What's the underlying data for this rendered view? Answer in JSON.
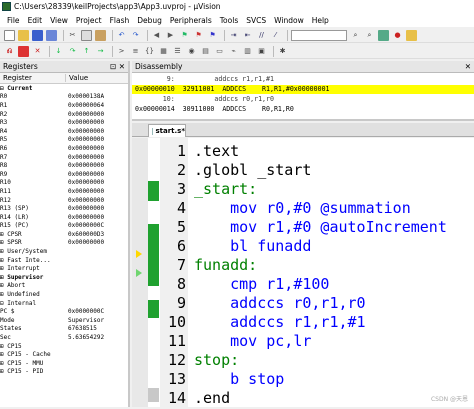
{
  "window": {
    "title": "C:\\Users\\28339\\keilProjects\\app3\\App3.uvproj - µVision"
  },
  "menu": [
    "File",
    "Edit",
    "View",
    "Project",
    "Flash",
    "Debug",
    "Peripherals",
    "Tools",
    "SVCS",
    "Window",
    "Help"
  ],
  "registers": {
    "title": "Registers",
    "col_register": "Register",
    "col_value": "Value",
    "rows": [
      {
        "n": "⊟ Current",
        "v": ""
      },
      {
        "n": "    R0",
        "v": "0x0000138A"
      },
      {
        "n": "    R1",
        "v": "0x00000064"
      },
      {
        "n": "    R2",
        "v": "0x00000000"
      },
      {
        "n": "    R3",
        "v": "0x00000000"
      },
      {
        "n": "    R4",
        "v": "0x00000000"
      },
      {
        "n": "    R5",
        "v": "0x00000000"
      },
      {
        "n": "    R6",
        "v": "0x00000000"
      },
      {
        "n": "    R7",
        "v": "0x00000000"
      },
      {
        "n": "    R8",
        "v": "0x00000000"
      },
      {
        "n": "    R9",
        "v": "0x00000000"
      },
      {
        "n": "    R10",
        "v": "0x00000000"
      },
      {
        "n": "    R11",
        "v": "0x00000000"
      },
      {
        "n": "    R12",
        "v": "0x00000000"
      },
      {
        "n": "    R13 (SP)",
        "v": "0x00000000"
      },
      {
        "n": "    R14 (LR)",
        "v": "0x00000000"
      },
      {
        "n": "    R15 (PC)",
        "v": "0x0000000C"
      },
      {
        "n": "  ⊞ CPSR",
        "v": "0x600000D3"
      },
      {
        "n": "  ⊞ SPSR",
        "v": "0x00000000"
      },
      {
        "n": "⊞ User/System",
        "v": ""
      },
      {
        "n": "⊞ Fast Inte...",
        "v": ""
      },
      {
        "n": "⊞ Interrupt",
        "v": ""
      },
      {
        "n": "⊞ Supervisor",
        "v": ""
      },
      {
        "n": "⊞ Abort",
        "v": ""
      },
      {
        "n": "⊞ Undefined",
        "v": ""
      },
      {
        "n": "⊟ Internal",
        "v": ""
      },
      {
        "n": "    PC  $",
        "v": "0x0000000C"
      },
      {
        "n": "    Mode",
        "v": "Supervisor"
      },
      {
        "n": "    States",
        "v": "67638515"
      },
      {
        "n": "    Sec",
        "v": "5.63654292"
      },
      {
        "n": "⊞ CP15",
        "v": ""
      },
      {
        "n": "⊞ CP15 - Cache",
        "v": ""
      },
      {
        "n": "⊞ CP15 - MMU",
        "v": ""
      },
      {
        "n": "⊞ CP15 - PID",
        "v": ""
      }
    ]
  },
  "disassembly": {
    "title": "Disassembly",
    "rows": [
      {
        "t": "        9:          addccs r1,r1,#1",
        "hl": false
      },
      {
        "t": "0x00000010  32911001  ADDCCS    R1,R1,#0x00000001",
        "hl": true
      },
      {
        "t": "       10:          addccs r0,r1,r0",
        "hl": false
      },
      {
        "t": "0x00000014  30911000  ADDCCS    R0,R1,R0",
        "hl": false
      }
    ]
  },
  "editor": {
    "tab": "start.s*",
    "lines": [
      {
        "num": "1",
        "code": ".text"
      },
      {
        "num": "2",
        "code": ".globl _start"
      },
      {
        "num": "3",
        "code": "_start:"
      },
      {
        "num": "4",
        "code": "    mov r0,#0 @summation"
      },
      {
        "num": "5",
        "code": "    mov r1,#0 @autoIncrement"
      },
      {
        "num": "6",
        "code": "    bl funadd"
      },
      {
        "num": "7",
        "code": "funadd:"
      },
      {
        "num": "8",
        "code": "    cmp r1,#100"
      },
      {
        "num": "9",
        "code": "    addccs r0,r1,r0"
      },
      {
        "num": "10",
        "code": "    addccs r1,r1,#1"
      },
      {
        "num": "11",
        "code": "    mov pc,lr"
      },
      {
        "num": "12",
        "code": "stop:"
      },
      {
        "num": "13",
        "code": "    b stop"
      },
      {
        "num": "14",
        "code": ".end"
      }
    ]
  },
  "watermark": "CSDN @天恩",
  "colors": {
    "coverage_green": "#1fa12f",
    "current_line": "#ffff00",
    "label": "#008000",
    "keyword": "#0000ff"
  },
  "icons": [
    "new-file-icon",
    "open-icon",
    "save-icon",
    "save-all-icon",
    "cut-icon",
    "copy-icon",
    "paste-icon",
    "undo-icon",
    "redo-icon",
    "reset-icon",
    "run-icon",
    "stop-icon",
    "step-into-icon",
    "step-over-icon",
    "step-out-icon",
    "run-to-cursor-icon",
    "settings-icon"
  ]
}
